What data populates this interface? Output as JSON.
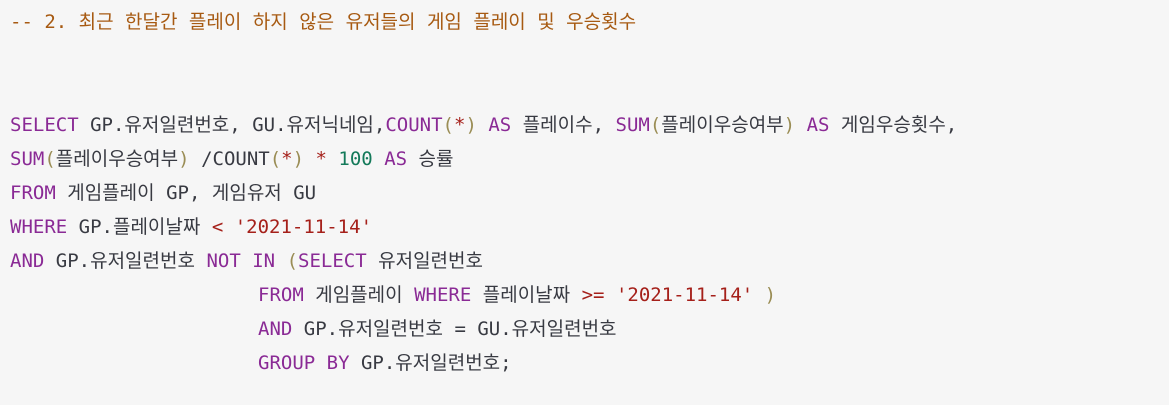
{
  "comment": "-- 2. 최근 한달간 플레이 하지 않은 유저들의 게임 플레이 및 우승횟수",
  "tokens": {
    "select": "SELECT",
    "from": "FROM",
    "where": "WHERE",
    "and": "AND",
    "not": "NOT",
    "in": "IN",
    "as": "AS",
    "count": "COUNT",
    "sum": "SUM",
    "group_by": "GROUP BY",
    "lparen": "(",
    "rparen": ")",
    "star": "*",
    "lt": "<",
    "gte": ">=",
    "eq": "=",
    "hundred": "100",
    "date": "'2021-11-14'"
  },
  "identifiers": {
    "gp_user_no": "GP.유저일련번호,",
    "gu_nick": "GU.유저닉네임,",
    "play_count_alias": "플레이수,",
    "win_yn": "플레이우승여부",
    "win_count_alias": "게임우승횟수,",
    "slash_count": "/COUNT",
    "win_rate_alias": "승률",
    "game_play": "게임플레이",
    "gp": "GP,",
    "game_user": "게임유저",
    "gu": "GU",
    "gp_play_date": "GP.플레이날짜",
    "gp_user_no_plain": "GP.유저일련번호",
    "user_no": "유저일련번호",
    "game_play2": "게임플레이",
    "play_date": "플레이날짜",
    "gu_user_no": "GU.유저일련번호",
    "gp_user_no_end": "GP.유저일련번호;"
  }
}
